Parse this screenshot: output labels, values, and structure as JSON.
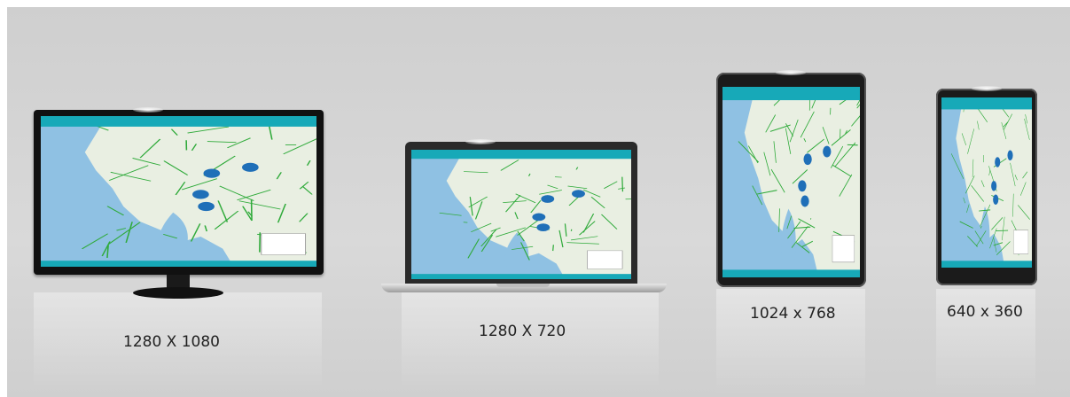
{
  "devices": [
    {
      "id": "monitor",
      "resolution": "1280 X 1080"
    },
    {
      "id": "laptop",
      "resolution": "1280 X 720"
    },
    {
      "id": "tablet",
      "resolution": "1024 x 768"
    },
    {
      "id": "phone",
      "resolution": "640 x 360"
    }
  ],
  "colors": {
    "app_header": "#17a9b8",
    "road": "#2faa3a",
    "sea": "#8fc1e3",
    "land": "#e9efe2",
    "marker": "#1f6fb8"
  }
}
